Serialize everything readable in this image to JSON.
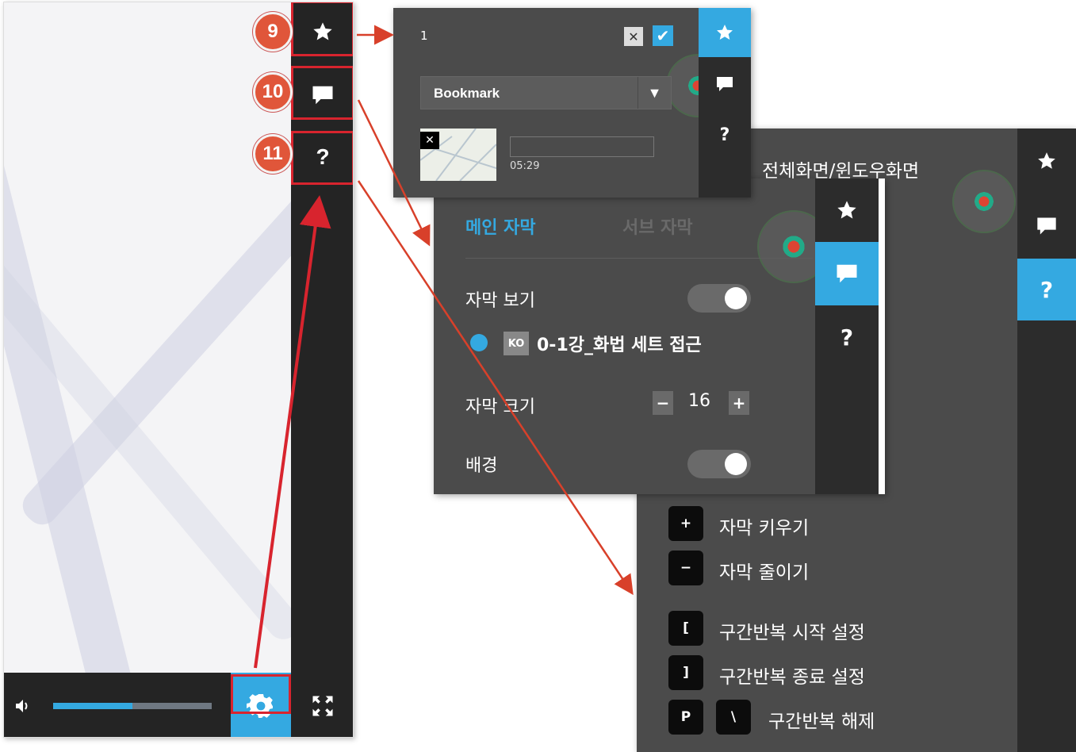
{
  "callouts": [
    "9",
    "10",
    "11"
  ],
  "player": {
    "sidebar": {
      "bookmark_icon": "star-icon",
      "caption_icon": "speech-bubble-icon",
      "help_label": "?"
    },
    "bottom": {
      "volume_icon": "speaker-icon",
      "volume_level": 0.5,
      "settings_icon": "gear-icon",
      "fullscreen_icon": "fullscreen-icon"
    }
  },
  "bookmark_panel": {
    "number": "1",
    "close_label": "✕",
    "confirm_label": "✔",
    "select_value": "Bookmark",
    "select_arrow": "▼",
    "thumb_delete_label": "✕",
    "timestamp": "05:29",
    "help_label": "?"
  },
  "caption_panel": {
    "tabs": [
      "메인 자막",
      "서브 자막"
    ],
    "show_caption_label": "자막 보기",
    "show_caption_on": true,
    "language_code": "KO",
    "track_name": "0-1강_화법 세트 접근",
    "size_label": "자막 크기",
    "size_minus": "−",
    "size_value": "16",
    "size_plus": "+",
    "background_label": "배경",
    "background_on": true,
    "help_label": "?"
  },
  "help_panel": {
    "header_text": "전체화면/윈도우화면",
    "help_label": "?",
    "shortcuts": [
      {
        "key": "+",
        "label": "자막 키우기"
      },
      {
        "key": "−",
        "label": "자막 줄이기"
      },
      {
        "key": "[",
        "label": "구간반복 시작 설정"
      },
      {
        "key": "]",
        "label": "구간반복 종료 설정"
      },
      {
        "key": "P",
        "key2": "\\",
        "label": "구간반복 해제"
      }
    ]
  },
  "colors": {
    "accent": "#34a9e1",
    "highlight": "#d8242e",
    "callout": "#e0563a",
    "panel": "#4b4b4b",
    "sidebar": "#242424"
  }
}
